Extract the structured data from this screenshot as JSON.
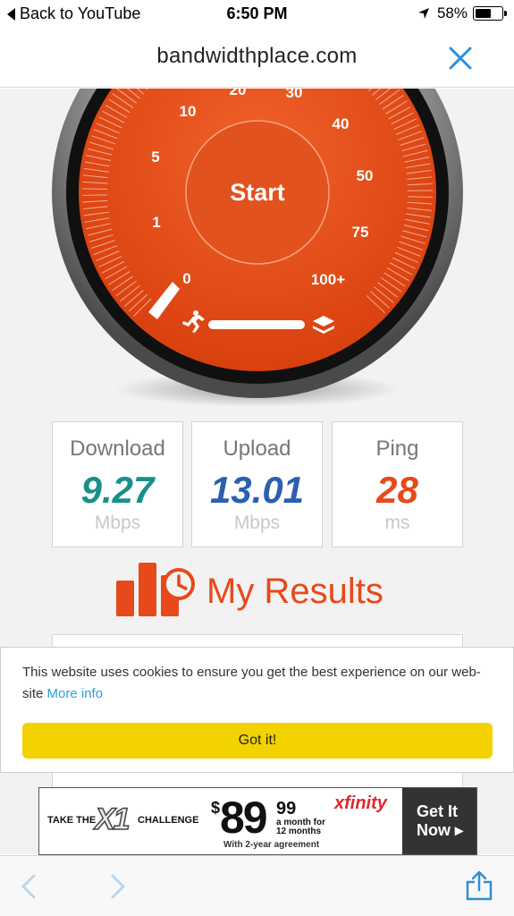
{
  "status_bar": {
    "back_label": "Back to YouTube",
    "time": "6:50 PM",
    "battery": "58%",
    "battery_level": 0.58
  },
  "browser": {
    "url": "bandwidthplace.com",
    "close_icon": "close-icon"
  },
  "gauge": {
    "start_label": "Start",
    "scale": [
      "0",
      "1",
      "5",
      "10",
      "20",
      "30",
      "40",
      "50",
      "75",
      "100+"
    ],
    "colors": {
      "face": "#e8491a",
      "center": "#e2521f",
      "bezel": "#8c8c8c"
    },
    "icons": [
      "runner-icon",
      "layers-icon"
    ]
  },
  "stats": [
    {
      "label": "Download",
      "value": "9.27",
      "unit": "Mbps",
      "color": "#1a8f8a"
    },
    {
      "label": "Upload",
      "value": "13.01",
      "unit": "Mbps",
      "color": "#2c5fb0"
    },
    {
      "label": "Ping",
      "value": "28",
      "unit": "ms",
      "color": "#e8491a"
    }
  ],
  "results": {
    "title": "My Results",
    "icon": "results-chart-icon",
    "color": "#e8491a"
  },
  "cookie": {
    "text": "This website uses cookies to ensure you get the best experience on our web-site",
    "link": "More info",
    "button": "Got it!",
    "button_color": "#f2d200"
  },
  "ad": {
    "take_the": "TAKE THE",
    "x1": "X1",
    "challenge": "CHALLENGE",
    "dollar": "$",
    "price": "89",
    "cents": "99",
    "per_month": "a month for",
    "months": "12 months",
    "agreement": "With 2-year agreement",
    "brand": "xfinity",
    "cta_line1": "Get It",
    "cta_line2": "Now ▸"
  },
  "toolbar": {
    "icons": [
      "back-arrow-icon",
      "forward-arrow-icon",
      "share-icon"
    ]
  }
}
